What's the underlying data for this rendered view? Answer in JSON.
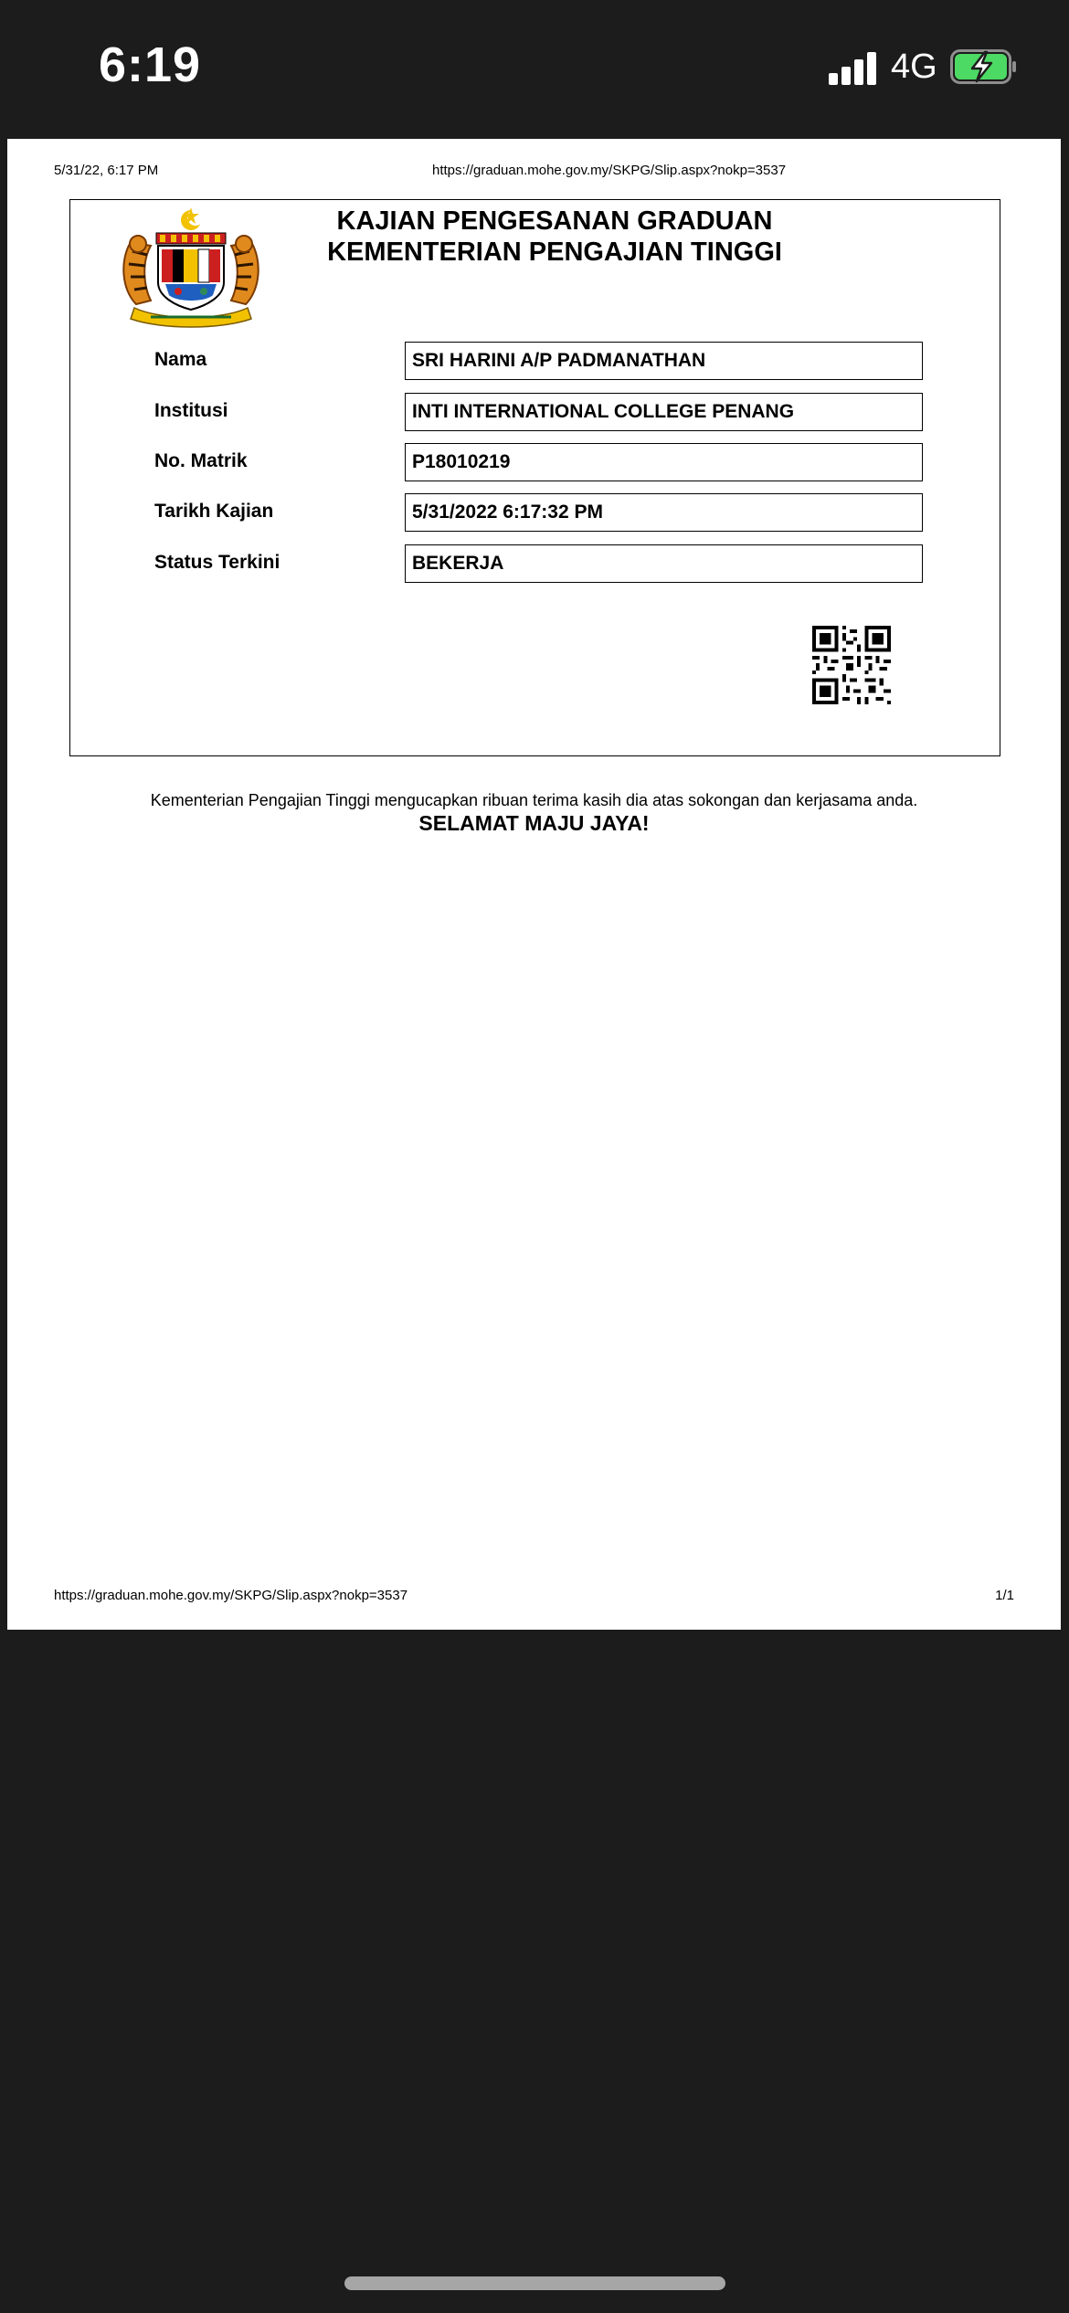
{
  "status_bar": {
    "time": "6:19",
    "network": "4G",
    "battery_state": "charging",
    "battery_color": "#4cd964",
    "signal_bars": 4
  },
  "print_header": {
    "date": "5/31/22, 6:17 PM",
    "url": "https://graduan.mohe.gov.my/SKPG/Slip.aspx?nokp=3537"
  },
  "slip": {
    "title_line1": "KAJIAN PENGESANAN GRADUAN",
    "title_line2": "KEMENTERIAN PENGAJIAN TINGGI",
    "emblem_icon": "malaysia-coat-of-arms-icon",
    "fields": [
      {
        "label": "Nama",
        "value": "SRI HARINI A/P PADMANATHAN"
      },
      {
        "label": "Institusi",
        "value": "INTI INTERNATIONAL COLLEGE PENANG"
      },
      {
        "label": "No. Matrik",
        "value": "P18010219"
      },
      {
        "label": "Tarikh Kajian",
        "value": "5/31/2022 6:17:32 PM"
      },
      {
        "label": "Status Terkini",
        "value": "BEKERJA"
      }
    ],
    "qr_icon": "qr-code-icon"
  },
  "thanks": {
    "message": "Kementerian Pengajian Tinggi mengucapkan ribuan terima kasih dia atas sokongan dan kerjasama anda.",
    "slogan": "SELAMAT MAJU JAYA!"
  },
  "print_footer": {
    "url": "https://graduan.mohe.gov.my/SKPG/Slip.aspx?nokp=3537",
    "page": "1/1"
  }
}
